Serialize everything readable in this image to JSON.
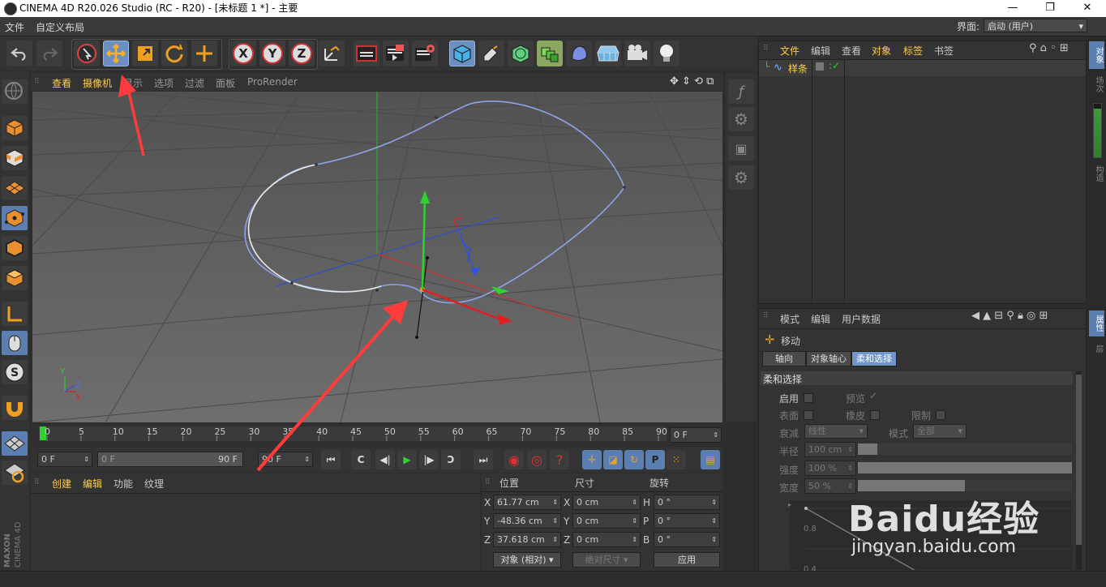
{
  "window": {
    "title": "CINEMA 4D R20.026 Studio (RC - R20) - [未标题 1 *] - 主要",
    "minimize": "—",
    "restore": "❐",
    "close": "✕"
  },
  "menubar": {
    "items": [
      "文件",
      "自定义布局"
    ],
    "layout_label": "界面:",
    "layout_value": "启动 (用户)"
  },
  "viewport": {
    "menu": [
      "查看",
      "摄像机",
      "显示",
      "选项",
      "过滤",
      "面板",
      "ProRender"
    ],
    "axis_labels": {
      "y": "Y",
      "z": "Z",
      "x": "X"
    }
  },
  "timeline": {
    "ticks": [
      "0",
      "5",
      "10",
      "15",
      "20",
      "25",
      "30",
      "35",
      "40",
      "45",
      "50",
      "55",
      "60",
      "65",
      "70",
      "75",
      "80",
      "85",
      "90"
    ],
    "current_frame": "0 F"
  },
  "transport": {
    "start_field": "0 F",
    "range_start": "0 F",
    "range_end": "90 F",
    "end_field": "90 F"
  },
  "material_panel": {
    "menu": [
      "创建",
      "编辑",
      "功能",
      "纹理"
    ]
  },
  "coords": {
    "headers": [
      "位置",
      "尺寸",
      "旋转"
    ],
    "rows": [
      {
        "axis": "X",
        "pos": "61.77 cm",
        "size_axis": "X",
        "size": "0 cm",
        "rot_axis": "H",
        "rot": "0 °"
      },
      {
        "axis": "Y",
        "pos": "-48.36 cm",
        "size_axis": "Y",
        "size": "0 cm",
        "rot_axis": "P",
        "rot": "0 °"
      },
      {
        "axis": "Z",
        "pos": "37.618 cm",
        "size_axis": "Z",
        "size": "0 cm",
        "rot_axis": "B",
        "rot": "0 °"
      }
    ],
    "mode": "对象 (相对)",
    "size_mode": "绝对尺寸",
    "apply": "应用"
  },
  "object_manager": {
    "menu": [
      "文件",
      "编辑",
      "查看",
      "对象",
      "标签",
      "书签"
    ],
    "object_name": "样条"
  },
  "attributes": {
    "menu": [
      "模式",
      "编辑",
      "用户数据"
    ],
    "tool_name": "移动",
    "tabs": [
      "轴向",
      "对象轴心",
      "柔和选择"
    ],
    "section": "柔和选择",
    "labels": {
      "enable": "启用",
      "preview": "预览",
      "surface": "表面",
      "rubber": "橡皮",
      "restrict": "限制",
      "falloff": "衰减",
      "mode": "模式",
      "radius": "半径",
      "strength": "强度",
      "width": "宽度"
    },
    "falloff_value": "线性",
    "mode_value": "全部",
    "radius_value": "100 cm",
    "strength_value": "100 %",
    "width_value": "50 %",
    "graph_ticks": [
      "0.8",
      "0.4"
    ]
  },
  "right_tabs": [
    "对象",
    "场次",
    "内容浏览器",
    "构造",
    "属性",
    "层"
  ],
  "brand": {
    "maxon": "MAXON",
    "c4d": "CINEMA 4D"
  },
  "watermark": {
    "text": "Baidu经验",
    "url": "jingyan.baidu.com"
  },
  "colors": {
    "accent_blue": "#5b7fb0",
    "selected_text": "#ffcf47",
    "arrow_red": "#ff3b3b"
  }
}
